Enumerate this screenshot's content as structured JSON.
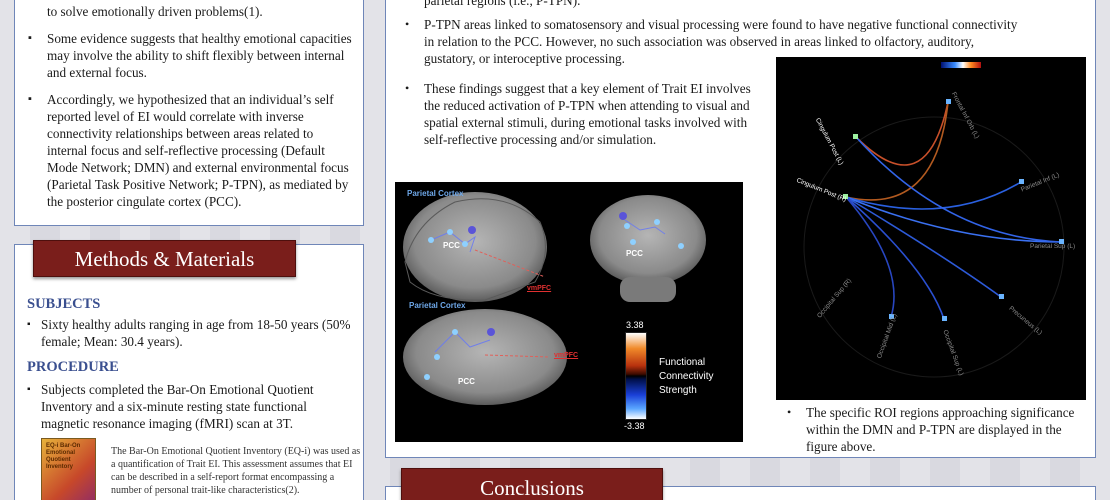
{
  "intro": {
    "first_line": "to solve emotionally driven problems(1).",
    "bullets": [
      "Some evidence suggests that healthy emotional capacities may involve the ability to shift flexibly between internal and external focus.",
      "Accordingly, we hypothesized that an individual’s self reported level of EI would correlate with inverse connectivity relationships between areas related to internal focus and self-reflective processing (Default Mode Network; DMN) and external environmental focus (Parietal Task Positive Network; P-TPN), as mediated by the posterior cingulate cortex (PCC)."
    ]
  },
  "methods": {
    "header": "Methods & Materials",
    "subjects_title": "SUBJECTS",
    "subjects_bullet": "Sixty healthy adults ranging in age from 18-50 years (50% female; Mean: 30.4 years).",
    "procedure_title": "PROCEDURE",
    "procedure_bullet": "Subjects completed the Bar-On Emotional Quotient Inventory and a six-minute resting state functional magnetic resonance imaging (fMRI) scan at 3T.",
    "eq_text": "The Bar-On Emotional Quotient Inventory (EQ-i) was used as a quantification of Trait EI. This assessment assumes that EI can be described in a self-report format encompassing a number of personal trait-like characteristics(2).",
    "book_text": "EQ-i Bar-On Emotional Quotient Inventory"
  },
  "results": {
    "top_line": "parietal regions (i.e., P-TPN).",
    "bullet_1": "P-TPN areas linked to somatosensory and visual processing were found to have negative functional connectivity in relation to the PCC. However, no such association was observed in areas linked to olfactory, auditory, gustatory, or interoceptive processing.",
    "bullet_2": "These findings suggest that a key element of Trait EI involves the reduced activation of P-TPN when attending to visual and spatial external stimuli, during emotional tasks involved with self-reflective processing and/or simulation.",
    "bullet_3": "The specific ROI regions approaching significance within the DMN and P-TPN are displayed in the figure above."
  },
  "brain_figure": {
    "parietal_cortex_1": "Parietal Cortex",
    "parietal_cortex_2": "Parietal Cortex",
    "pcc_1": "PCC",
    "pcc_2": "PCC",
    "pcc_3": "PCC",
    "vmpfc_1": "vmPFC",
    "vmpfc_2": "vmPFC",
    "scale_max": "3.38",
    "scale_min": "-3.38",
    "legend_line1": "Functional",
    "legend_line2": "Connectivity",
    "legend_line3": "Strength"
  },
  "circle_figure": {
    "labels": {
      "cingulum_post_l": "Cingulum Post (L)",
      "cingulum_post_r": "Cingulum Post (R)",
      "frontal_inf": "Frontal Inf Orb (L)",
      "parietal_inf": "Parietal Inf (L)",
      "parietal_sup": "Parietal Sup (L)",
      "precuneus": "Precuneus (L)",
      "occipital_sup_l": "Occipital Sup (L)",
      "occipital_mid": "Occipital Mid (L)",
      "occipital_sup_r": "Occipital Sup (R)"
    }
  },
  "conclusions": {
    "header": "Conclusions"
  },
  "colors": {
    "header_bg": "#7a1e1b",
    "subhead": "#3a4f8f",
    "panel_border": "#6f86b8"
  }
}
